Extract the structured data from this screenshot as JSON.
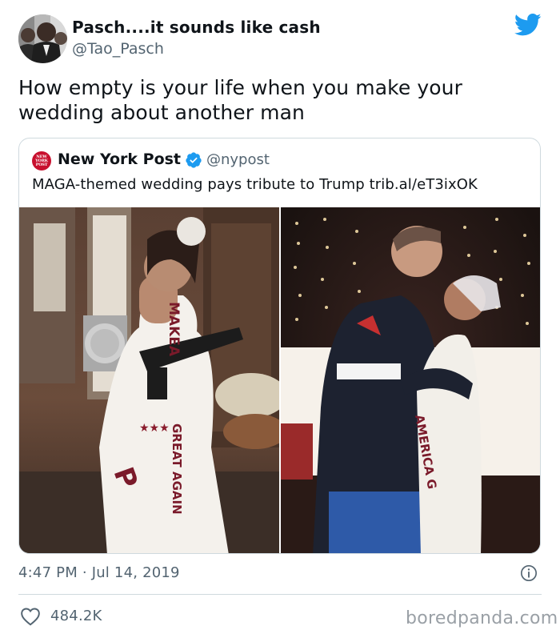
{
  "author": {
    "display_name": "Pasch....it sounds like cash",
    "handle": "@Tao_Pasch"
  },
  "tweet_text": "How empty is your life when you make your wedding about another man",
  "quoted_tweet": {
    "logo_text": "NEW YORK POST",
    "display_name": "New York Post",
    "handle": "@nypost",
    "text": "MAGA-themed wedding pays tribute to Trump trib.al/eT3ixOK",
    "photos": [
      {
        "dress_text": "MAKE AMERICA GREAT AGAIN",
        "dress_text_top": "MAKEA",
        "dress_text_bottom": "GREAT AGAIN",
        "dress_letter": "P"
      },
      {
        "dress_text": "AMERICA G"
      }
    ]
  },
  "timestamp": "4:47 PM · Jul 14, 2019",
  "likes": "484.2K",
  "watermark": "boredpanda.com",
  "colors": {
    "twitter_blue": "#1d9bf0",
    "text_primary": "#0f1419",
    "text_secondary": "#536471",
    "border": "#cfd9de",
    "nypost_red": "#c8102e"
  },
  "icons": {
    "brand": "twitter-bird-icon",
    "verified": "verified-badge-icon",
    "info": "info-icon",
    "like": "heart-icon"
  }
}
